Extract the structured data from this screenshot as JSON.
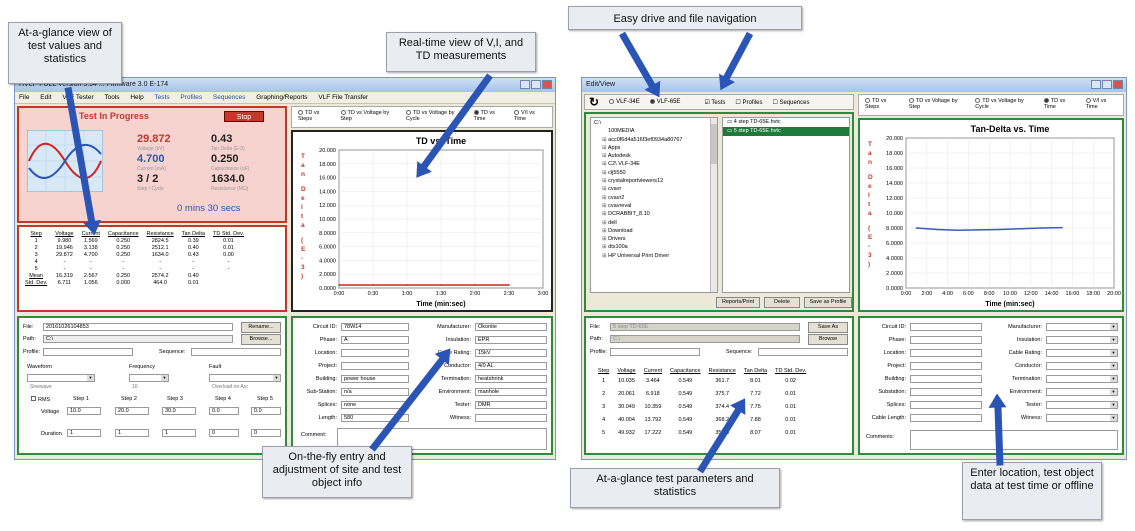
{
  "callouts": {
    "glance": "At-a-glance view of test values and statistics",
    "realtime": "Real-time view of V,I, and TD measurements",
    "drive": "Easy drive and file navigation",
    "onfly": "On-the-fly entry and adjustment of site and test object info",
    "params": "At-a-glance test parameters and statistics",
    "enter": "Enter location, test object data at test time or offline"
  },
  "left": {
    "title": "HVLF-FULL Version 5.94 ... Firmware 3.0 E-174",
    "menu": [
      "File",
      "Edit",
      "VLF Tester",
      "Tools",
      "Help",
      "Tests",
      "Profiles",
      "Sequences",
      "Graphing/Reports",
      "VLF File Transfer"
    ],
    "status": {
      "heading": "Test In Progress",
      "stop": "Stop",
      "voltage": "29.872",
      "voltage_lbl": "Voltage (kV)",
      "tandelta": "0.43",
      "tandelta_lbl": "Tan Delta (E-3)",
      "current": "4.700",
      "current_lbl": "Current (mA)",
      "capacitance": "0.250",
      "capacitance_lbl": "Capacitance (uF)",
      "step": "3 / 2",
      "step_lbl": "Step / Cycle",
      "resistance": "1634.0",
      "resistance_lbl": "Resistance (MΩ)",
      "time": "0 mins 30 secs"
    },
    "table": {
      "headers": [
        "Step",
        "Voltage",
        "Current",
        "Capacitance",
        "Resistance",
        "Tan Delta",
        "TD Std. Dev."
      ],
      "rows": [
        [
          "1",
          "9.980",
          "1.569",
          "0.250",
          "2824.5",
          "0.39",
          "0.01"
        ],
        [
          "2",
          "19.946",
          "3.138",
          "0.250",
          "2512.1",
          "0.40",
          "0.01"
        ],
        [
          "3",
          "29.872",
          "4.700",
          "0.250",
          "1634.0",
          "0.43",
          "0.00"
        ],
        [
          "4",
          "-",
          "-",
          "-",
          "-",
          "-",
          "-"
        ],
        [
          "5",
          "-",
          "-",
          "-",
          "-",
          "-",
          "-"
        ],
        [
          "Mean",
          "16.319",
          "2.567",
          "0.250",
          "2574.2",
          "0.40",
          ""
        ],
        [
          "Std. Dev.",
          "6.711",
          "1.056",
          "0.000",
          "464.0",
          "0.01",
          ""
        ]
      ]
    },
    "radios": [
      "TD vs Steps",
      "TD vs Voltage by Step",
      "TD vs Voltage by Cycle",
      "TD vs Time",
      "V/I vs Time"
    ],
    "file": {
      "file_lbl": "File:",
      "file_val": "20161026104853",
      "rename": "Rename...",
      "path_lbl": "Path:",
      "path_val": "C:\\",
      "browse": "Browse...",
      "profile_lbl": "Profile:",
      "sequence_lbl": "Sequence:",
      "waveform_lbl": "Waveform",
      "waveform_val": "Sinewave",
      "frequency_lbl": "Frequency",
      "frequency_val": "10",
      "fault_lbl": "Fault",
      "fault_val": "Overload on Arc",
      "rms": "RMS",
      "steps": [
        "Step 1",
        "Step 2",
        "Step 3",
        "Step 4",
        "Step 5"
      ],
      "voltage_lbl": "Voltage",
      "voltages": [
        "10.0",
        "20.0",
        "30.0",
        "0.0",
        "0.0"
      ],
      "duration_lbl": "Duration",
      "durations": [
        "1",
        "1",
        "1",
        "0",
        "0"
      ]
    },
    "site": {
      "left": [
        [
          "Circuit ID:",
          "78W14"
        ],
        [
          "Phase:",
          "A"
        ],
        [
          "Location:",
          ""
        ],
        [
          "Project:",
          ""
        ],
        [
          "Building:",
          "power house"
        ],
        [
          "Sub-Station:",
          "n/a"
        ],
        [
          "Splices:",
          "none"
        ],
        [
          "Length:",
          "580"
        ]
      ],
      "right": [
        [
          "Manufacturer:",
          "Okonite"
        ],
        [
          "Insulation:",
          "EPR"
        ],
        [
          "Cable Rating:",
          "15kV"
        ],
        [
          "Conductor:",
          "4/0 AL"
        ],
        [
          "Termination:",
          "heatshrink"
        ],
        [
          "Environment:",
          "manhole"
        ],
        [
          "Tester:",
          "DMR"
        ],
        [
          "Witness:",
          ""
        ]
      ],
      "comment": "Comment:"
    }
  },
  "right": {
    "title": "Edit/View",
    "radios_top": [
      "VLF-34E",
      "VLF-65E"
    ],
    "checks": [
      "Tests",
      "Profiles",
      "Sequences"
    ],
    "tree": [
      "C:\\",
      "100MEDIA",
      "acc0f6d4a516f3ef0934a80767",
      "Apps",
      "Autodesk",
      "C2\\ VLF-34E",
      "clj5550",
      "crystalreportviewers12",
      "cvavr",
      "cvavr2",
      "cvavreval",
      "DCRABBIT_8.10",
      "dell",
      "Download",
      "Drivers",
      "dts100a",
      "HP Universal Print Driver"
    ],
    "files": [
      "4 step TD-65E.hvtc",
      "5 step TD-65E.hvtc"
    ],
    "buttons": [
      "Reports/Print",
      "Delete",
      "Save as Profile"
    ],
    "radios": [
      "TD vs Steps",
      "TD vs Voltage by Step",
      "TD vs Voltage by Cycle",
      "TD vs Time",
      "V/I vs Time"
    ],
    "file": {
      "file_lbl": "File:",
      "file_val": "5 step TD-65E",
      "saveas": "Save As",
      "path_lbl": "Path:",
      "path_val": "C:\\",
      "browse": "Browse",
      "profile_lbl": "Profile:",
      "sequence_lbl": "Sequence:"
    },
    "table": {
      "headers": [
        "Step",
        "Voltage",
        "Current",
        "Capacitance",
        "Resistance",
        "Tan Delta",
        "TD Std. Dev."
      ],
      "rows": [
        [
          "1",
          "10.035",
          "3.464",
          "0.549",
          "361.7",
          "8.01",
          "0.02"
        ],
        [
          "2",
          "20.061",
          "6.918",
          "0.549",
          "375.7",
          "7.72",
          "0.01"
        ],
        [
          "3",
          "30.049",
          "10.359",
          "0.549",
          "374.4",
          "7.75",
          "0.01"
        ],
        [
          "4",
          "40.004",
          "13.792",
          "0.549",
          "368.2",
          "7.88",
          "0.01"
        ],
        [
          "5",
          "49.932",
          "17.222",
          "0.549",
          "359.3",
          "8.07",
          "0.01"
        ]
      ]
    },
    "site": {
      "left": [
        "Circuit ID:",
        "Phase:",
        "Location:",
        "Project:",
        "Building:",
        "Substation:",
        "Splices:",
        "Cable Length:"
      ],
      "right": [
        "Manufacturer:",
        "Insulation:",
        "Cable Rating:",
        "Conductor:",
        "Termination:",
        "Environment:",
        "Tester:",
        "Witness:"
      ],
      "comments": "Comments:"
    }
  },
  "chart_data": [
    {
      "type": "line",
      "title": "TD vs. Time",
      "xlabel": "Time (min:sec)",
      "ylabel": "Tan Delta (E-3)",
      "xticks": [
        "0:00",
        "0:30",
        "1:00",
        "1:30",
        "2:00",
        "2:30",
        "3:00"
      ],
      "yticks": [
        "0.0000",
        "2.0000",
        "4.0000",
        "6.0000",
        "8.0000",
        "10.000",
        "12.000",
        "14.000",
        "16.000",
        "18.000",
        "20.000"
      ],
      "xlim": [
        0,
        180
      ],
      "ylim": [
        0,
        20
      ],
      "x": [
        0,
        30,
        60,
        90,
        120,
        150
      ],
      "y": [
        0.43,
        0.43,
        0.43,
        0.43,
        0.43,
        0.43
      ],
      "color": "#d62020"
    },
    {
      "type": "line",
      "title": "Tan-Delta vs. Time",
      "xlabel": "Time (min:sec)",
      "ylabel": "Tan Delta (E-3)",
      "xticks": [
        "0:00",
        "2:00",
        "4:00",
        "6:00",
        "8:00",
        "10:00",
        "12:00",
        "14:00",
        "16:00",
        "18:00",
        "20:00"
      ],
      "yticks": [
        "0.0000",
        "2.0000",
        "4.0000",
        "6.0000",
        "8.0000",
        "10.000",
        "12.000",
        "14.000",
        "16.000",
        "18.000",
        "20.000"
      ],
      "xlim": [
        0,
        1200
      ],
      "ylim": [
        0,
        20
      ],
      "x": [
        60,
        180,
        300,
        420,
        540,
        660,
        780,
        900
      ],
      "y": [
        8.0,
        7.8,
        7.7,
        7.75,
        7.8,
        7.9,
        8.0,
        8.05
      ],
      "color": "#3b5cb8"
    }
  ]
}
